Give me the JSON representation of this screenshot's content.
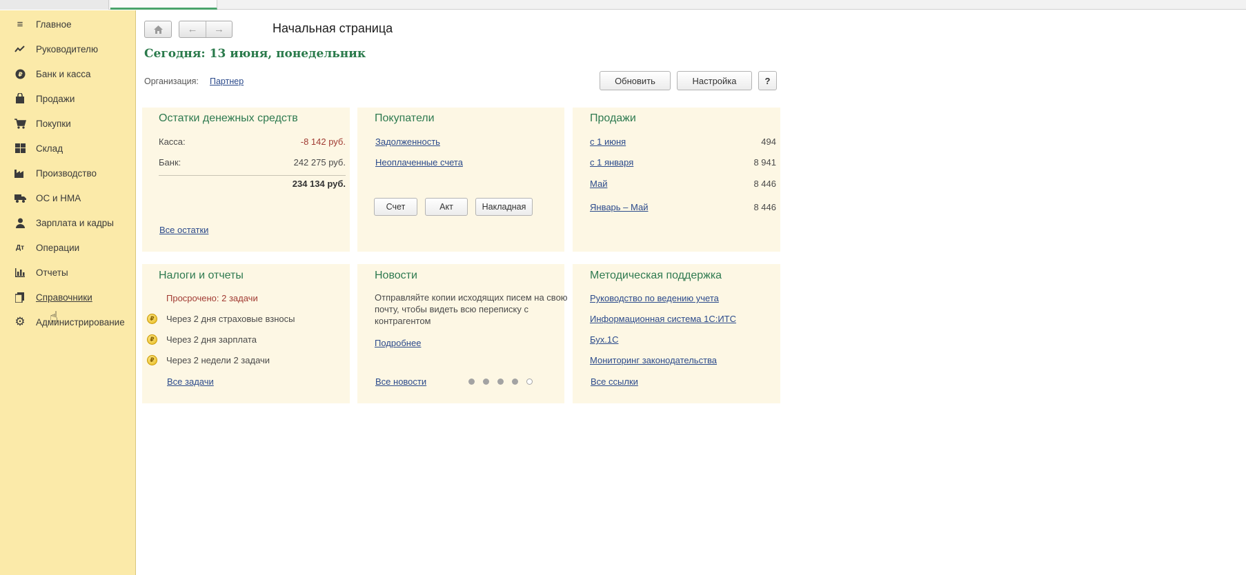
{
  "sidebar": {
    "items": [
      {
        "label": "Главное",
        "icon": "menu-lines-icon"
      },
      {
        "label": "Руководителю",
        "icon": "trend-chart-icon"
      },
      {
        "label": "Банк и касса",
        "icon": "ruble-coin-icon"
      },
      {
        "label": "Продажи",
        "icon": "shopping-bag-icon"
      },
      {
        "label": "Покупки",
        "icon": "shopping-cart-icon"
      },
      {
        "label": "Склад",
        "icon": "warehouse-grid-icon"
      },
      {
        "label": "Производство",
        "icon": "factory-icon"
      },
      {
        "label": "ОС и НМА",
        "icon": "truck-icon"
      },
      {
        "label": "Зарплата и кадры",
        "icon": "person-icon"
      },
      {
        "label": "Операции",
        "icon": "dt-kt-icon"
      },
      {
        "label": "Отчеты",
        "icon": "bar-chart-icon"
      },
      {
        "label": "Справочники",
        "icon": "books-icon"
      },
      {
        "label": "Администрирование",
        "icon": "gear-icon"
      }
    ]
  },
  "header": {
    "page_title": "Начальная страница",
    "today": "Сегодня: 13 июня, понедельник",
    "org_label": "Организация:",
    "org_value": "Партнер",
    "refresh_label": "Обновить",
    "settings_label": "Настройка",
    "help_label": "?"
  },
  "cash": {
    "title": "Остатки денежных средств",
    "kassa_label": "Касса:",
    "kassa_value": "-8 142 руб.",
    "bank_label": "Банк:",
    "bank_value": "242 275 руб.",
    "total_value": "234 134 руб.",
    "all_link": "Все остатки"
  },
  "buyers": {
    "title": "Покупатели",
    "debt_link": "Задолженность",
    "unpaid_link": "Неоплаченные счета",
    "btn_invoice": "Счет",
    "btn_act": "Акт",
    "btn_waybill": "Накладная"
  },
  "sales": {
    "title": "Продажи",
    "rows": [
      {
        "label": "с 1 июня",
        "value": "494"
      },
      {
        "label": "с 1 января",
        "value": "8 941"
      },
      {
        "label": "Май",
        "value": "8 446"
      },
      {
        "label": "Январь – Май",
        "value": "8 446"
      }
    ]
  },
  "taxes": {
    "title": "Налоги и отчеты",
    "overdue": "Просрочено: 2 задачи",
    "items": [
      "Через 2 дня страховые взносы",
      "Через 2 дня зарплата",
      "Через 2 недели 2 задачи"
    ],
    "all_link": "Все задачи"
  },
  "news": {
    "title": "Новости",
    "text": "Отправляйте копии исходящих писем на свою почту, чтобы видеть всю переписку с контрагентом",
    "more_link": "Подробнее",
    "all_link": "Все новости",
    "pages_total": 5,
    "current_page": 5
  },
  "support": {
    "title": "Методическая поддержка",
    "links": [
      "Руководство по ведению учета",
      "Информационная система 1С:ИТС",
      "Бух.1С",
      "Мониторинг законодательства"
    ],
    "all_link": "Все ссылки"
  }
}
